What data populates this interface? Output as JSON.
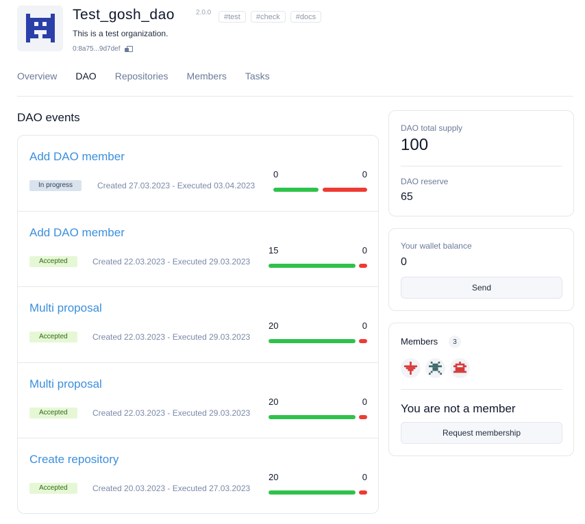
{
  "header": {
    "name": "Test_gosh_dao",
    "version": "2.0.0",
    "tags": [
      "#test",
      "#check",
      "#docs"
    ],
    "description": "This is a test organization.",
    "address": "0:8a75...9d7def",
    "logo_icon": "dao-logo-icon",
    "copy_icon": "copy-icon"
  },
  "tabs": [
    {
      "label": "Overview",
      "active": false
    },
    {
      "label": "DAO",
      "active": true
    },
    {
      "label": "Repositories",
      "active": false
    },
    {
      "label": "Members",
      "active": false
    },
    {
      "label": "Tasks",
      "active": false
    }
  ],
  "events": {
    "title": "DAO events",
    "items": [
      {
        "title": "Add DAO member",
        "status": "In progress",
        "status_kind": "progress",
        "dates": "Created 27.03.2023 - Executed 03.04.2023",
        "votes_for": "0",
        "votes_against": "0"
      },
      {
        "title": "Add DAO member",
        "status": "Accepted",
        "status_kind": "accepted",
        "dates": "Created 22.03.2023 - Executed 29.03.2023",
        "votes_for": "15",
        "votes_against": "0"
      },
      {
        "title": "Multi proposal",
        "status": "Accepted",
        "status_kind": "accepted",
        "dates": "Created 22.03.2023 - Executed 29.03.2023",
        "votes_for": "20",
        "votes_against": "0"
      },
      {
        "title": "Multi proposal",
        "status": "Accepted",
        "status_kind": "accepted",
        "dates": "Created 22.03.2023 - Executed 29.03.2023",
        "votes_for": "20",
        "votes_against": "0"
      },
      {
        "title": "Create repository",
        "status": "Accepted",
        "status_kind": "accepted",
        "dates": "Created 20.03.2023 - Executed 27.03.2023",
        "votes_for": "20",
        "votes_against": "0"
      }
    ]
  },
  "supply": {
    "total_label": "DAO total supply",
    "total_value": "100",
    "reserve_label": "DAO reserve",
    "reserve_value": "65"
  },
  "wallet": {
    "label": "Your wallet balance",
    "value": "0",
    "send_label": "Send"
  },
  "members": {
    "title": "Members",
    "count": "3",
    "avatars": [
      "red-pixel-avatar",
      "teal-pixel-avatar",
      "red-pixel-avatar"
    ],
    "not_member_text": "You are not a member",
    "request_label": "Request membership"
  },
  "colors": {
    "accent": "#3b8fdc",
    "vote_for": "#2fc24b",
    "vote_against": "#ee3b33",
    "logo": "#2b3fa8"
  }
}
